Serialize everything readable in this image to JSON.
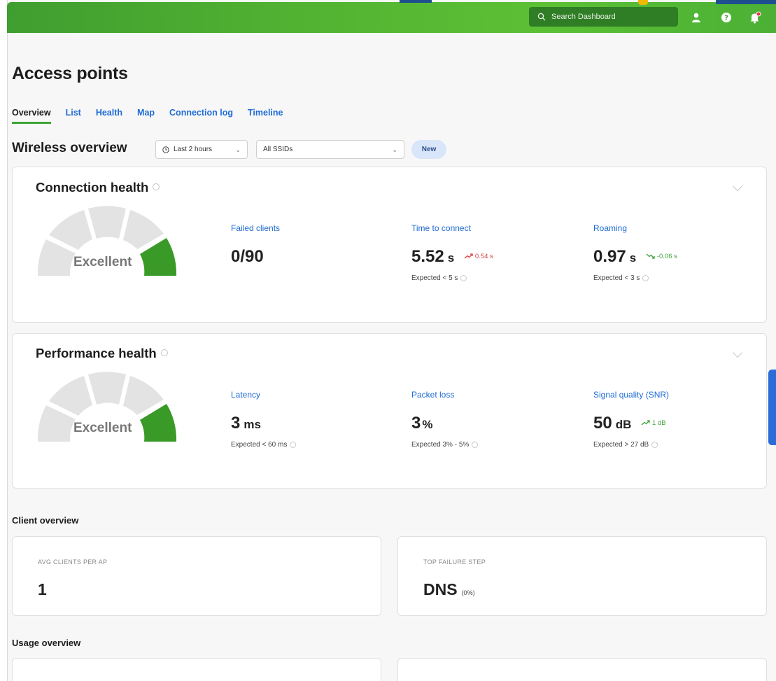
{
  "header": {
    "search_placeholder": "Search Dashboard",
    "icons": [
      "user-icon",
      "help-icon",
      "notification-bell-icon"
    ],
    "brand_color": "#4bb035"
  },
  "page": {
    "title": "Access points",
    "tabs": [
      {
        "label": "Overview",
        "active": true
      },
      {
        "label": "List"
      },
      {
        "label": "Health"
      },
      {
        "label": "Map"
      },
      {
        "label": "Connection log"
      },
      {
        "label": "Timeline"
      }
    ]
  },
  "wireless": {
    "title": "Wireless overview",
    "time_filter": "Last 2 hours",
    "ssid_filter": "All SSIDs",
    "new_badge": "New"
  },
  "connection_health": {
    "title": "Connection health",
    "gauge_label": "Excellent",
    "gauge_level": "Excellent",
    "metrics": [
      {
        "label": "Failed clients",
        "value": "0/90",
        "unit": "",
        "delta": "",
        "expected": ""
      },
      {
        "label": "Time to connect",
        "value": "5.52",
        "unit": "s",
        "delta": "0.54 s",
        "expected": "Expected < 5 s"
      },
      {
        "label": "Roaming",
        "value": "0.97",
        "unit": "s",
        "delta": "-0.06 s",
        "expected": "Expected < 3 s"
      }
    ]
  },
  "performance_health": {
    "title": "Performance health",
    "gauge_label": "Excellent",
    "gauge_level": "Excellent",
    "metrics": [
      {
        "label": "Latency",
        "value": "3",
        "unit": "ms",
        "delta": "",
        "expected": "Expected < 60 ms"
      },
      {
        "label": "Packet loss",
        "value": "3",
        "unit": "%",
        "delta": "",
        "expected": "Expected 3% - 5%"
      },
      {
        "label": "Signal quality (SNR)",
        "value": "50",
        "unit": "dB",
        "delta": "1 dB",
        "expected": "Expected > 27 dB"
      }
    ]
  },
  "client_overview": {
    "title": "Client overview",
    "cards": [
      {
        "caption": "AVG CLIENTS PER AP",
        "value": "1",
        "sub": ""
      },
      {
        "caption": "TOP FAILURE STEP",
        "value": "DNS",
        "sub": "(0%)"
      }
    ]
  },
  "usage_overview": {
    "title": "Usage overview"
  },
  "colors": {
    "accent_blue": "#1f6bd6",
    "gauge_green": "#3a9a28",
    "gauge_grey": "#e3e3e3",
    "delta_red": "#d93d3d",
    "delta_green": "#3da237"
  }
}
